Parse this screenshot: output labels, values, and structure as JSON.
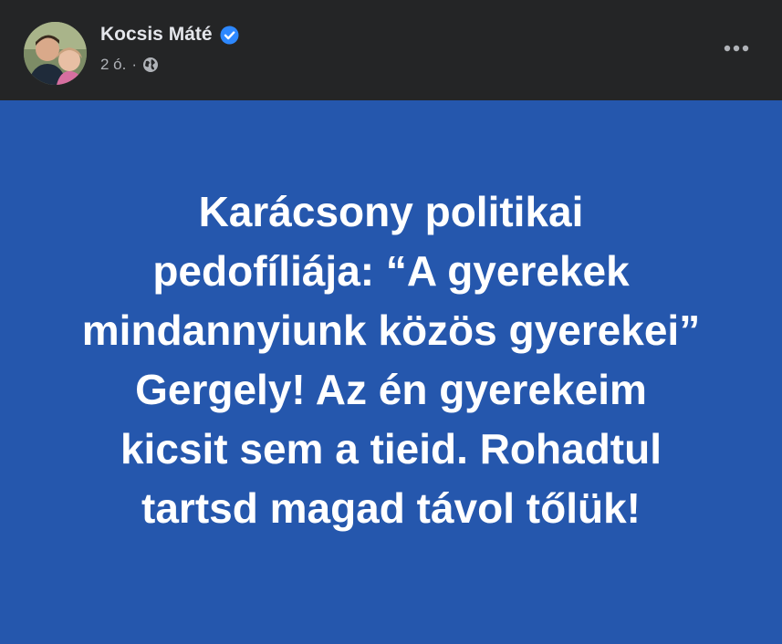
{
  "author": {
    "name": "Kocsis Máté",
    "verified": true,
    "avatar_icon": "profile-photo"
  },
  "meta": {
    "time": "2 ó.",
    "separator": "·",
    "audience_icon": "globe-icon"
  },
  "more_icon": "more-options-icon",
  "post": {
    "background_color": "#2557ad",
    "text_color": "#ffffff",
    "lines": [
      "Karácsony politikai",
      "pedofíliája: “A gyerekek",
      "mindannyiunk közös gyerekei”",
      "Gergely! Az én gyerekeim",
      "kicsit sem a tieid. Rohadtul",
      "tartsd magad távol tőlük!"
    ]
  },
  "colors": {
    "header_bg": "#242526",
    "name_text": "#e4e6eb",
    "meta_text": "#b0b3b8",
    "verified_badge": "#2d88ff"
  }
}
